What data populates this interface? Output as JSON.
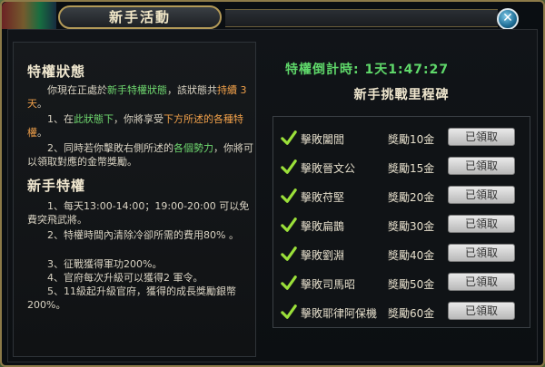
{
  "window": {
    "title": "新手活動",
    "close_symbol": "✕"
  },
  "status": {
    "heading": "特權狀態",
    "para1_prefix": "你現在正處於",
    "para1_green": "新手特權狀態",
    "para1_mid": "，該狀態共",
    "para1_orange": "持續 3天",
    "para1_end": "。",
    "point1_prefix": "1、在",
    "point1_green": "此狀態下",
    "point1_mid": "，你將享受",
    "point1_orange": "下方所述的各種特權",
    "point1_end": "。",
    "point2_prefix": "2、同時若你擊敗右側所述的",
    "point2_green": "各個勢力",
    "point2_mid": "，你將可以領取對應的金幣獎勵。"
  },
  "perks": {
    "heading": "新手特權",
    "items": [
      "1、每天13:00-14:00；19:00-20:00 可以免費突飛武將。",
      "2、特權時間內清除冷卻所需的費用80% 。",
      "3、征戰獲得軍功200%。",
      "4、官府每次升級可以獲得2 軍令。",
      "5、11級起升級官府，獲得的成長獎勵銀幣200%。"
    ]
  },
  "countdown": {
    "label": "特權倒計時:",
    "value": "1天1:47:27"
  },
  "milestones": {
    "title": "新手挑戰里程碑",
    "rows": [
      {
        "name": "擊敗闔閭",
        "reward": "獎勵10金",
        "button": "已領取"
      },
      {
        "name": "擊敗晉文公",
        "reward": "獎勵15金",
        "button": "已領取"
      },
      {
        "name": "擊敗苻堅",
        "reward": "獎勵20金",
        "button": "已領取"
      },
      {
        "name": "擊敗扁鵲",
        "reward": "獎勵30金",
        "button": "已領取"
      },
      {
        "name": "擊敗劉淵",
        "reward": "獎勵40金",
        "button": "已領取"
      },
      {
        "name": "擊敗司馬昭",
        "reward": "獎勵50金",
        "button": "已領取"
      },
      {
        "name": "擊敗耶律阿保機",
        "reward": "獎勵60金",
        "button": "已領取"
      }
    ]
  },
  "colors": {
    "accent_green": "#5fd86a",
    "accent_orange": "#f0a04a",
    "frame_gold": "#b39a58"
  }
}
